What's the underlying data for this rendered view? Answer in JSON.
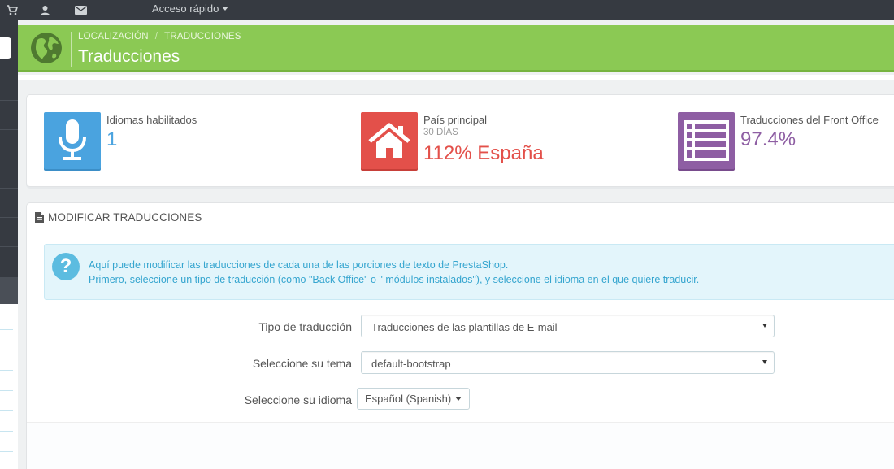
{
  "topbar": {
    "icons": [
      "cart-icon",
      "user-icon",
      "envelope-icon"
    ],
    "quick_access_label": "Acceso rápido"
  },
  "header": {
    "breadcrumb": [
      "LOCALIZACIÓN",
      "/",
      "TRADUCCIONES"
    ],
    "title": "Traducciones",
    "icon": "globe-icon"
  },
  "kpis": [
    {
      "icon": "microphone-icon",
      "label": "Idiomas habilitados",
      "sub": "",
      "value": "1",
      "color": "#4aa3df",
      "value_color": "#4aa3df"
    },
    {
      "icon": "home-icon",
      "label": "País principal",
      "sub": "30 DÍAS",
      "value": "112% España",
      "color": "#e3504a",
      "value_color": "#e3504a"
    },
    {
      "icon": "list-icon",
      "label": "Traducciones del Front Office",
      "sub": "",
      "value": "97.4%",
      "color": "#8e5ea3",
      "value_color": "#8e5ea3"
    }
  ],
  "panel": {
    "heading": "MODIFICAR TRADUCCIONES",
    "heading_icon": "file-icon",
    "alert": {
      "icon": "question-icon",
      "line1": "Aquí puede modificar las traducciones de cada una de las porciones de texto de PrestaShop.",
      "line2": "Primero, seleccione un tipo de traducción (como \"Back Office\" o \" módulos instalados\"), y seleccione el idioma en el que quiere traducir."
    },
    "form": {
      "type_label": "Tipo de traducción",
      "type_value": "Traducciones de las plantillas de E-mail",
      "theme_label": "Seleccione su tema",
      "theme_value": "default-bootstrap",
      "language_label": "Seleccione su idioma",
      "language_value": "Español (Spanish)"
    }
  },
  "colors": {
    "header_green": "#8bc954",
    "topbar": "#363a41",
    "info_text": "#35a5cf"
  }
}
